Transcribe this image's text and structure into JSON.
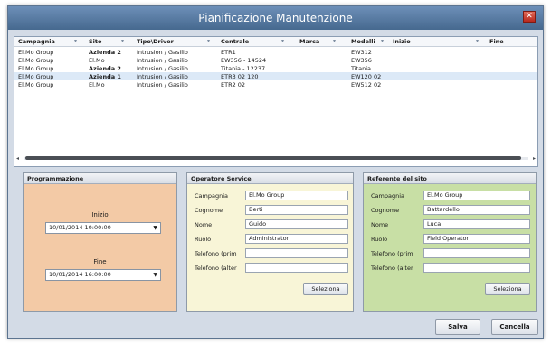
{
  "window": {
    "title": "Pianificazione Manutenzione",
    "close_glyph": "✕"
  },
  "grid": {
    "columns": [
      "Campagnia",
      "Sito",
      "Tipo\\Driver",
      "Centrale",
      "Marca",
      "Modelli",
      "Inizio",
      "Fine"
    ],
    "rows": [
      [
        "El.Mo Group",
        "Azienda 2",
        "Intrusion / Gasilio",
        "ETR1",
        "",
        "EW312",
        ""
      ],
      [
        "El.Mo Group",
        "El.Mo",
        "Intrusion / Gasilio",
        "EW356 - 14524",
        "",
        "EW356",
        ""
      ],
      [
        "El.Mo Group",
        "Azienda 2",
        "Intrusion / Gasilio",
        "Titania - 12237",
        "",
        "Titania",
        ""
      ],
      [
        "El.Mo Group",
        "Azienda 1",
        "Intrusion / Gasilio",
        "ETR3 02 120",
        "",
        "EW120 02",
        ""
      ],
      [
        "El.Mo Group",
        "El.Mo",
        "Intrusion / Gasilio",
        "ETR2 02",
        "",
        "EW512 02",
        ""
      ]
    ]
  },
  "programmazione": {
    "title": "Programmazione",
    "inizio_label": "Inizio",
    "inizio_value": "10/01/2014 10:00:00",
    "fine_label": "Fine",
    "fine_value": "10/01/2014 16:00:00"
  },
  "operatore": {
    "title": "Operatore Service",
    "fields": [
      {
        "label": "Campagnia",
        "value": "El.Mo Group"
      },
      {
        "label": "Cognome",
        "value": "Berti"
      },
      {
        "label": "Nome",
        "value": "Guido"
      },
      {
        "label": "Ruolo",
        "value": "Administrator"
      },
      {
        "label": "Telefono (prim",
        "value": ""
      },
      {
        "label": "Telefono (alter",
        "value": ""
      }
    ],
    "select_label": "Seleziona"
  },
  "referente": {
    "title": "Referente del sito",
    "fields": [
      {
        "label": "Campagnia",
        "value": "El.Mo Group"
      },
      {
        "label": "Cognome",
        "value": "Battardello"
      },
      {
        "label": "Nome",
        "value": "Luca"
      },
      {
        "label": "Ruolo",
        "value": "Field Operator"
      },
      {
        "label": "Telefono (prim",
        "value": ""
      },
      {
        "label": "Telefono (alter",
        "value": ""
      }
    ],
    "select_label": "Seleziona"
  },
  "footer": {
    "save_label": "Salva",
    "cancel_label": "Cancella"
  }
}
